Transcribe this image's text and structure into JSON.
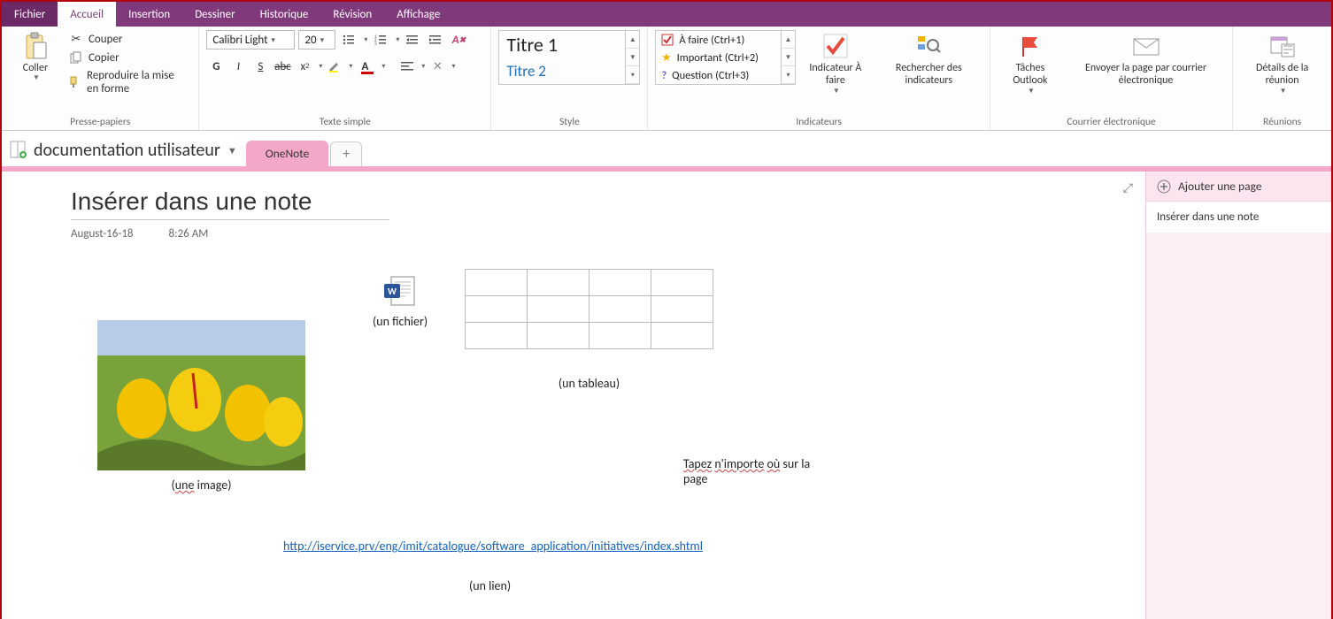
{
  "tabs": {
    "file": "Fichier",
    "items": [
      "Accueil",
      "Insertion",
      "Dessiner",
      "Historique",
      "Révision",
      "Affichage"
    ],
    "active_index": 0
  },
  "ribbon": {
    "clipboard": {
      "paste": "Coller",
      "cut": "Couper",
      "copy": "Copier",
      "format_painter": "Reproduire la mise en forme",
      "label": "Presse-papiers"
    },
    "font": {
      "name": "Calibri Light",
      "size": "20",
      "label": "Texte simple"
    },
    "styles": {
      "items": [
        "Titre 1",
        "Titre 2"
      ],
      "label": "Style"
    },
    "tags": {
      "items": [
        {
          "icon": "checkbox",
          "label": "À faire (Ctrl+1)"
        },
        {
          "icon": "star",
          "label": "Important (Ctrl+2)"
        },
        {
          "icon": "question",
          "label": "Question (Ctrl+3)"
        }
      ],
      "todo": "Indicateur À faire",
      "find": "Rechercher des indicateurs",
      "label": "Indicateurs"
    },
    "outlook": {
      "tasks": "Tâches Outlook",
      "email": "Envoyer la page par courrier électronique",
      "label": "Courrier électronique"
    },
    "meeting": {
      "details": "Détails de la réunion",
      "label": "Réunions"
    }
  },
  "notebook": {
    "title": "documentation utilisateur",
    "section": "OneNote"
  },
  "pages": {
    "add": "Ajouter une page",
    "items": [
      "Insérer dans une note"
    ]
  },
  "canvas": {
    "title": "Insérer dans une note",
    "date": "August-16-18",
    "time": "8:26 AM",
    "image_caption": "(une image)",
    "file_caption": "(un fichier)",
    "table_caption": "(un tableau)",
    "hint_line1": "Tapez n'importe où sur la",
    "hint_w1": "Tapez",
    "hint_w2": "n'importe",
    "hint_w3": "où",
    "hint_plain": " sur la",
    "hint_line2": "page",
    "link_url": "http://iservice.prv/eng/imit/catalogue/software_application/initiatives/index.shtml",
    "link_caption": "(un lien)"
  }
}
